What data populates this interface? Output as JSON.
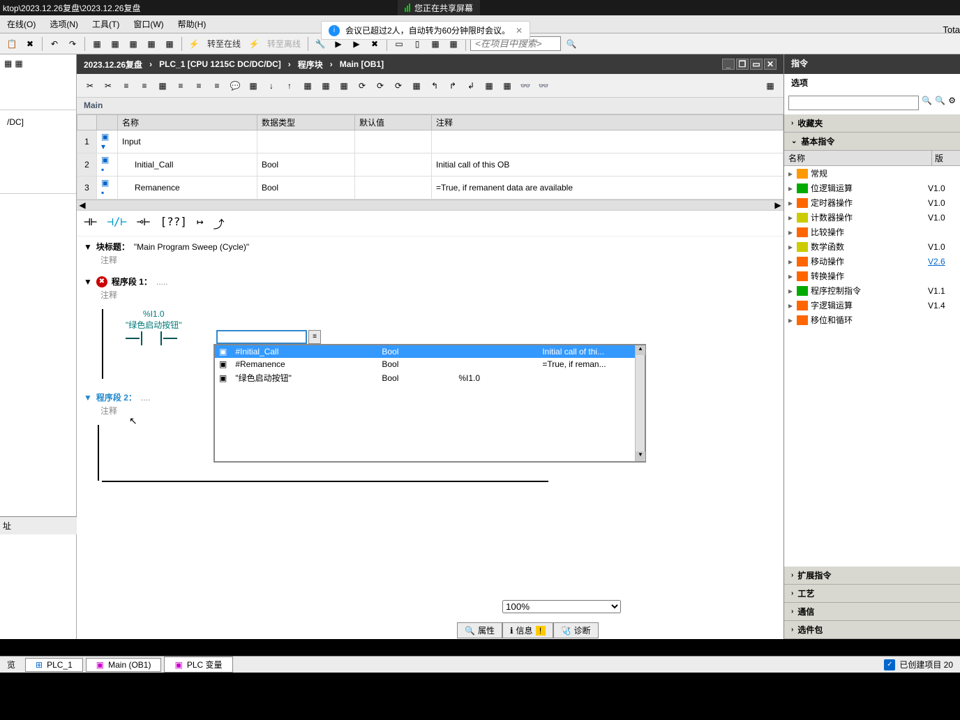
{
  "titlebar": {
    "path": "ktop\\2023.12.26复盘\\2023.12.26复盘"
  },
  "sharing": {
    "text": "您正在共享屏幕"
  },
  "menubar": [
    "在线(O)",
    "选项(N)",
    "工具(T)",
    "窗口(W)",
    "帮助(H)"
  ],
  "meeting_notice": {
    "text": "会议已超过2人，自动转为60分钟限时会议。"
  },
  "total_label": "Tota",
  "toolbar": {
    "go_online": "转至在线",
    "go_offline": "转至离线",
    "search_placeholder": "<在项目中搜索>"
  },
  "left": {
    "dc_label": "/DC]",
    "addr_label": "址"
  },
  "breadcrumb": [
    "2023.12.26复盘",
    "PLC_1 [CPU 1215C DC/DC/DC]",
    "程序块",
    "Main [OB1]"
  ],
  "main_label": "Main",
  "params": {
    "headers": [
      "名称",
      "数据类型",
      "默认值",
      "注释"
    ],
    "rows": [
      {
        "num": "1",
        "name": "Input",
        "type": "",
        "def": "",
        "comment": "",
        "expand": true
      },
      {
        "num": "2",
        "name": "Initial_Call",
        "type": "Bool",
        "def": "",
        "comment": "Initial call of this OB"
      },
      {
        "num": "3",
        "name": "Remanence",
        "type": "Bool",
        "def": "",
        "comment": "=True, if remanent data are available"
      }
    ]
  },
  "block": {
    "title_label": "块标题：",
    "title_text": "\"Main Program Sweep (Cycle)\"",
    "comment_label": "注释"
  },
  "network1": {
    "label": "程序段 1：",
    "dots": ".....",
    "comment": "注释",
    "contact": {
      "addr": "%I1.0",
      "tag": "\"绿色启动按钮\""
    }
  },
  "autocomplete": {
    "rows": [
      {
        "name": "#Initial_Call",
        "type": "Bool",
        "addr": "",
        "comment": "Initial call of thi..."
      },
      {
        "name": "#Remanence",
        "type": "Bool",
        "addr": "",
        "comment": "=True, if reman..."
      },
      {
        "name": "\"绿色启动按钮\"",
        "type": "Bool",
        "addr": "%I1.0",
        "comment": ""
      }
    ]
  },
  "network2": {
    "label": "程序段 2：",
    "dots": "....",
    "comment": "注释"
  },
  "zoom": "100%",
  "bottom_tabs": {
    "properties": "属性",
    "info": "信息",
    "diagnostics": "诊断"
  },
  "right": {
    "title": "指令",
    "options": "选项",
    "favorites": "收藏夹",
    "basic": "基本指令",
    "hdr_name": "名称",
    "hdr_ver": "版",
    "items": [
      {
        "name": "常规",
        "ver": "",
        "ico": "folder-ico"
      },
      {
        "name": "位逻辑运算",
        "ver": "V1.0",
        "ico": "green-ico"
      },
      {
        "name": "定时器操作",
        "ver": "V1.0",
        "ico": "orange-ico"
      },
      {
        "name": "计数器操作",
        "ver": "V1.0",
        "ico": "yellow-ico"
      },
      {
        "name": "比较操作",
        "ver": "",
        "ico": "orange-ico"
      },
      {
        "name": "数学函数",
        "ver": "V1.0",
        "ico": "yellow-ico"
      },
      {
        "name": "移动操作",
        "ver": "V2.6",
        "ico": "orange-ico",
        "link": true
      },
      {
        "name": "转换操作",
        "ver": "",
        "ico": "orange-ico"
      },
      {
        "name": "程序控制指令",
        "ver": "V1.1",
        "ico": "green-ico"
      },
      {
        "name": "字逻辑运算",
        "ver": "V1.4",
        "ico": "orange-ico"
      },
      {
        "name": "移位和循环",
        "ver": "",
        "ico": "orange-ico"
      }
    ],
    "sections": [
      "扩展指令",
      "工艺",
      "通信",
      "选件包"
    ]
  },
  "statusbar": {
    "overview": "览",
    "tabs": [
      "PLC_1",
      "Main (OB1)",
      "PLC 变量"
    ],
    "status": "已创建项目 20"
  }
}
